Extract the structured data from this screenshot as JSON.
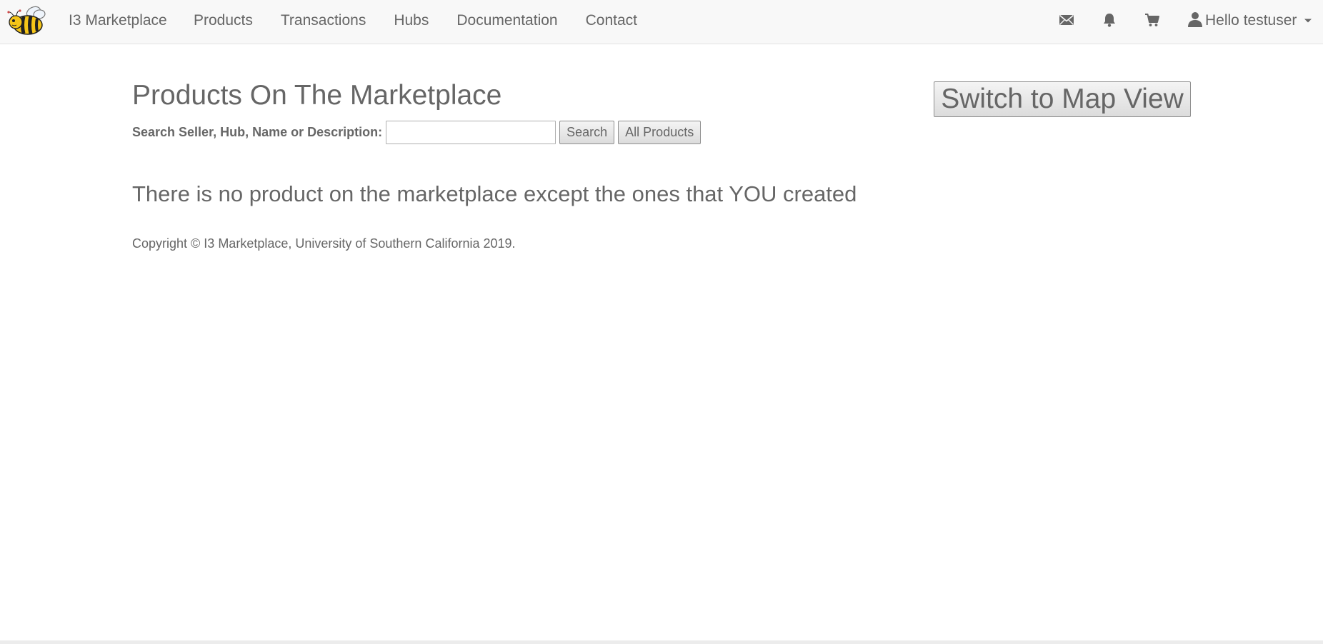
{
  "navbar": {
    "logo_icon": "bee-logo-icon",
    "brand": "I3 Marketplace",
    "links": [
      "Products",
      "Transactions",
      "Hubs",
      "Documentation",
      "Contact"
    ],
    "icons": [
      "envelope-icon",
      "bell-icon",
      "shopping-cart-icon"
    ],
    "user": {
      "icon": "person-icon",
      "greeting": "Hello testuser"
    }
  },
  "main": {
    "title": "Products On The Marketplace",
    "map_view_button": "Switch to Map View",
    "search": {
      "label": "Search Seller, Hub, Name or Description:",
      "value": "",
      "placeholder": "",
      "search_button": "Search",
      "all_button": "All Products"
    },
    "empty_message": "There is no product on the marketplace except the ones that YOU created",
    "footer": "Copyright © I3 Marketplace, University of Southern California 2019."
  },
  "colors": {
    "navbar_bg": "#f8f8f8",
    "text": "#666666",
    "bee_yellow": "#f5c518"
  }
}
